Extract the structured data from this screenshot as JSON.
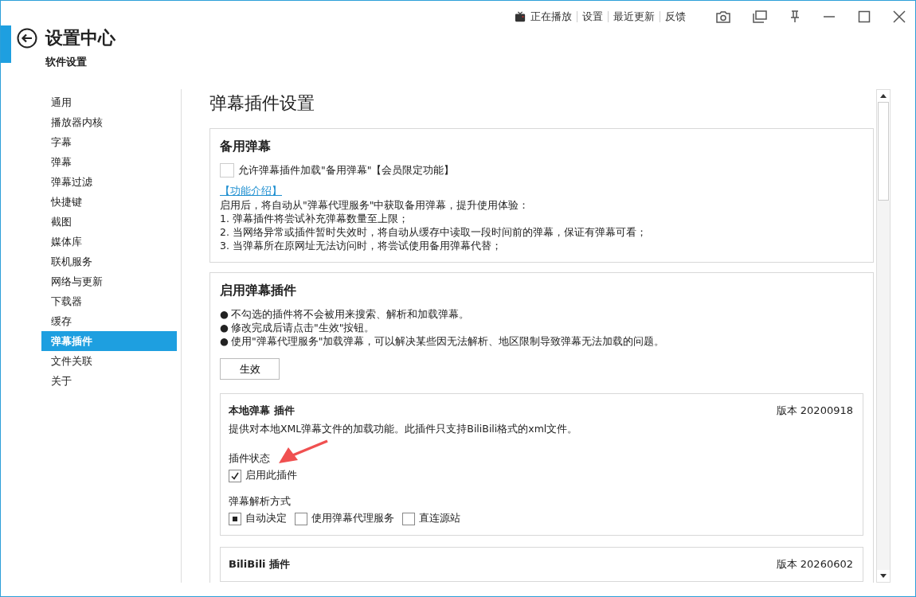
{
  "title_bar": {
    "links": [
      "正在播放",
      "设置",
      "最近更新",
      "反馈"
    ]
  },
  "header": {
    "title": "设置中心",
    "subtitle": "软件设置"
  },
  "sidebar": {
    "items": [
      {
        "label": "通用",
        "selected": false
      },
      {
        "label": "播放器内核",
        "selected": false
      },
      {
        "label": "字幕",
        "selected": false
      },
      {
        "label": "弹幕",
        "selected": false
      },
      {
        "label": "弹幕过滤",
        "selected": false
      },
      {
        "label": "快捷键",
        "selected": false
      },
      {
        "label": "截图",
        "selected": false
      },
      {
        "label": "媒体库",
        "selected": false
      },
      {
        "label": "联机服务",
        "selected": false
      },
      {
        "label": "网络与更新",
        "selected": false
      },
      {
        "label": "下载器",
        "selected": false
      },
      {
        "label": "缓存",
        "selected": false
      },
      {
        "label": "弹幕插件",
        "selected": true
      },
      {
        "label": "文件关联",
        "selected": false
      },
      {
        "label": "关于",
        "selected": false
      }
    ]
  },
  "page_title": "弹幕插件设置",
  "backup_section": {
    "title": "备用弹幕",
    "checkbox": {
      "label": "允许弹幕插件加载\"备用弹幕\"【会员限定功能】",
      "checked": false
    },
    "link": "【功能介绍】",
    "lines": [
      "启用后，将自动从\"弹幕代理服务\"中获取备用弹幕，提升使用体验：",
      "1. 弹幕插件将尝试补充弹幕数量至上限；",
      "2. 当网络异常或插件暂时失效时，将自动从缓存中读取一段时间前的弹幕，保证有弹幕可看；",
      "3. 当弹幕所在原网址无法访问时，将尝试使用备用弹幕代替；"
    ]
  },
  "plugins_section": {
    "title": "启用弹幕插件",
    "bullets": [
      "不勾选的插件将不会被用来搜索、解析和加载弹幕。",
      "修改完成后请点击\"生效\"按钮。",
      "使用\"弹幕代理服务\"加载弹幕，可以解决某些因无法解析、地区限制导致弹幕无法加载的问题。"
    ],
    "bullet_mark": "●",
    "apply_button": "生效",
    "plugins": [
      {
        "name": "本地弹幕 插件",
        "version": "版本 20200918",
        "description": "提供对本地XML弹幕文件的加载功能。此插件只支持BiliBili格式的xml文件。",
        "status_label": "插件状态",
        "enable": {
          "label": "启用此插件",
          "checked": true
        },
        "mode_label": "弹幕解析方式",
        "modes": [
          {
            "label": "自动决定",
            "selected": true
          },
          {
            "label": "使用弹幕代理服务",
            "selected": false
          },
          {
            "label": "直连源站",
            "selected": false
          }
        ]
      },
      {
        "name": "BiliBili 插件",
        "version": "版本 20260602"
      }
    ]
  }
}
